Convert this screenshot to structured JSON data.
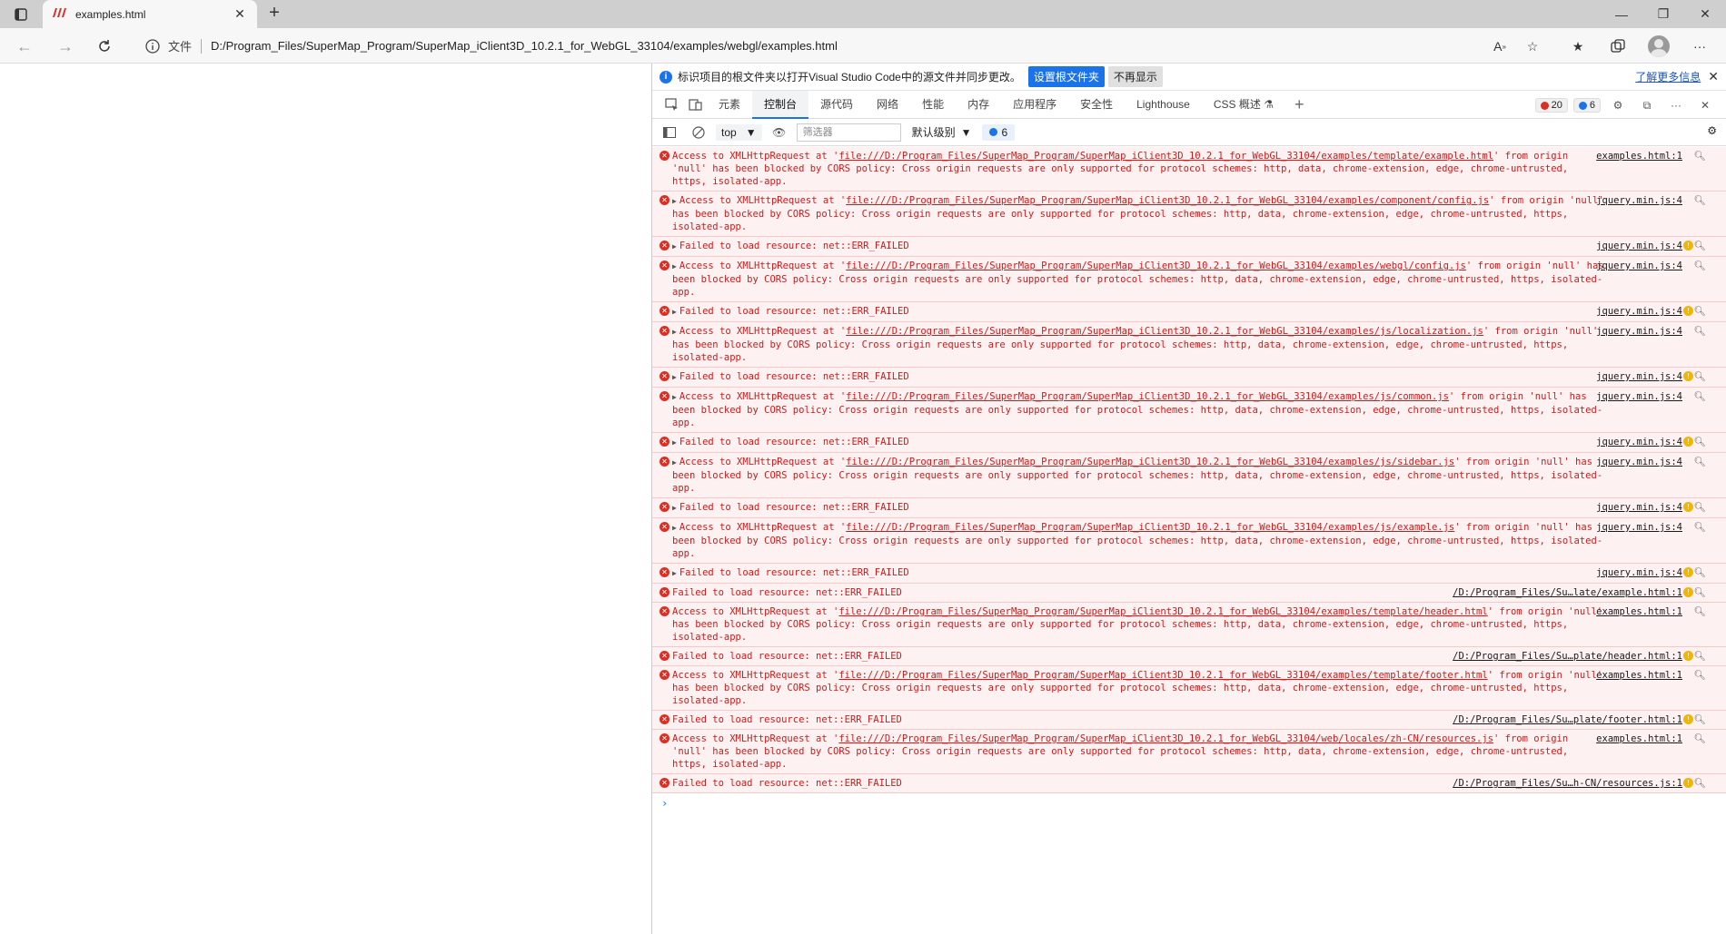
{
  "browser": {
    "tab_title": "examples.html",
    "address_label": "文件",
    "url": "D:/Program_Files/SuperMap_Program/SuperMap_iClient3D_10.2.1_for_WebGL_33104/examples/webgl/examples.html"
  },
  "devtools": {
    "infobar": {
      "message": "标识项目的根文件夹以打开Visual Studio Code中的源文件并同步更改。",
      "primary_button": "设置根文件夹",
      "secondary_button": "不再显示",
      "learn_more": "了解更多信息"
    },
    "tabs": [
      "元素",
      "控制台",
      "源代码",
      "网络",
      "性能",
      "内存",
      "应用程序",
      "安全性",
      "Lighthouse",
      "CSS 概述"
    ],
    "active_tab": "控制台",
    "error_count": "20",
    "info_count": "6",
    "toolbar": {
      "context": "top",
      "filter_placeholder": "筛选器",
      "level": "默认级别",
      "issues_count": "6"
    },
    "messages": [
      {
        "expand": false,
        "pre": "Access to XMLHttpRequest at '",
        "link": "file:///D:/Program_Files/SuperMap_Program/SuperMap_iClient3D_10.2.1_for_WebGL_33104/examples/template/example.html",
        "post": "' from origin 'null' has been blocked by CORS policy: Cross origin requests are only supported for protocol schemes: http, data, chrome-extension, edge, chrome-untrusted, https, isolated-app.",
        "source": "examples.html:1",
        "warn": false
      },
      {
        "expand": true,
        "pre": "Access to XMLHttpRequest at '",
        "link": "file:///D:/Program_Files/SuperMap_Program/SuperMap_iClient3D_10.2.1_for_WebGL_33104/examples/component/config.js",
        "post": "' from origin 'null' has been blocked by CORS policy: Cross origin requests are only supported for protocol schemes: http, data, chrome-extension, edge, chrome-untrusted, https, isolated-app.",
        "source": "jquery.min.js:4",
        "warn": false
      },
      {
        "expand": true,
        "pre": "Failed to load resource: net::ERR_FAILED",
        "link": "",
        "post": "",
        "source": "jquery.min.js:4",
        "warn": true
      },
      {
        "expand": true,
        "pre": "Access to XMLHttpRequest at '",
        "link": "file:///D:/Program_Files/SuperMap_Program/SuperMap_iClient3D_10.2.1_for_WebGL_33104/examples/webgl/config.js",
        "post": "' from origin 'null' has been blocked by CORS policy: Cross origin requests are only supported for protocol schemes: http, data, chrome-extension, edge, chrome-untrusted, https, isolated-app.",
        "source": "jquery.min.js:4",
        "warn": false
      },
      {
        "expand": true,
        "pre": "Failed to load resource: net::ERR_FAILED",
        "link": "",
        "post": "",
        "source": "jquery.min.js:4",
        "warn": true
      },
      {
        "expand": true,
        "pre": "Access to XMLHttpRequest at '",
        "link": "file:///D:/Program_Files/SuperMap_Program/SuperMap_iClient3D_10.2.1_for_WebGL_33104/examples/js/localization.js",
        "post": "' from origin 'null' has been blocked by CORS policy: Cross origin requests are only supported for protocol schemes: http, data, chrome-extension, edge, chrome-untrusted, https, isolated-app.",
        "source": "jquery.min.js:4",
        "warn": false
      },
      {
        "expand": true,
        "pre": "Failed to load resource: net::ERR_FAILED",
        "link": "",
        "post": "",
        "source": "jquery.min.js:4",
        "warn": true
      },
      {
        "expand": true,
        "pre": "Access to XMLHttpRequest at '",
        "link": "file:///D:/Program_Files/SuperMap_Program/SuperMap_iClient3D_10.2.1_for_WebGL_33104/examples/js/common.js",
        "post": "' from origin 'null' has been blocked by CORS policy: Cross origin requests are only supported for protocol schemes: http, data, chrome-extension, edge, chrome-untrusted, https, isolated-app.",
        "source": "jquery.min.js:4",
        "warn": false
      },
      {
        "expand": true,
        "pre": "Failed to load resource: net::ERR_FAILED",
        "link": "",
        "post": "",
        "source": "jquery.min.js:4",
        "warn": true
      },
      {
        "expand": true,
        "pre": "Access to XMLHttpRequest at '",
        "link": "file:///D:/Program_Files/SuperMap_Program/SuperMap_iClient3D_10.2.1_for_WebGL_33104/examples/js/sidebar.js",
        "post": "' from origin 'null' has been blocked by CORS policy: Cross origin requests are only supported for protocol schemes: http, data, chrome-extension, edge, chrome-untrusted, https, isolated-app.",
        "source": "jquery.min.js:4",
        "warn": false
      },
      {
        "expand": true,
        "pre": "Failed to load resource: net::ERR_FAILED",
        "link": "",
        "post": "",
        "source": "jquery.min.js:4",
        "warn": true
      },
      {
        "expand": true,
        "pre": "Access to XMLHttpRequest at '",
        "link": "file:///D:/Program_Files/SuperMap_Program/SuperMap_iClient3D_10.2.1_for_WebGL_33104/examples/js/example.js",
        "post": "' from origin 'null' has been blocked by CORS policy: Cross origin requests are only supported for protocol schemes: http, data, chrome-extension, edge, chrome-untrusted, https, isolated-app.",
        "source": "jquery.min.js:4",
        "warn": false
      },
      {
        "expand": true,
        "pre": "Failed to load resource: net::ERR_FAILED",
        "link": "",
        "post": "",
        "source": "jquery.min.js:4",
        "warn": true
      },
      {
        "expand": false,
        "pre": "Failed to load resource: net::ERR_FAILED",
        "link": "",
        "post": "",
        "source": "/D:/Program_Files/Su…late/example.html:1",
        "warn": true
      },
      {
        "expand": false,
        "pre": "Access to XMLHttpRequest at '",
        "link": "file:///D:/Program_Files/SuperMap_Program/SuperMap_iClient3D_10.2.1_for_WebGL_33104/examples/template/header.html",
        "post": "' from origin 'null' has been blocked by CORS policy: Cross origin requests are only supported for protocol schemes: http, data, chrome-extension, edge, chrome-untrusted, https, isolated-app.",
        "source": "examples.html:1",
        "warn": false
      },
      {
        "expand": false,
        "pre": "Failed to load resource: net::ERR_FAILED",
        "link": "",
        "post": "",
        "source": "/D:/Program_Files/Su…plate/header.html:1",
        "warn": true
      },
      {
        "expand": false,
        "pre": "Access to XMLHttpRequest at '",
        "link": "file:///D:/Program_Files/SuperMap_Program/SuperMap_iClient3D_10.2.1_for_WebGL_33104/examples/template/footer.html",
        "post": "' from origin 'null' has been blocked by CORS policy: Cross origin requests are only supported for protocol schemes: http, data, chrome-extension, edge, chrome-untrusted, https, isolated-app.",
        "source": "examples.html:1",
        "warn": false
      },
      {
        "expand": false,
        "pre": "Failed to load resource: net::ERR_FAILED",
        "link": "",
        "post": "",
        "source": "/D:/Program_Files/Su…plate/footer.html:1",
        "warn": true
      },
      {
        "expand": false,
        "pre": "Access to XMLHttpRequest at '",
        "link": "file:///D:/Program_Files/SuperMap_Program/SuperMap_iClient3D_10.2.1_for_WebGL_33104/web/locales/zh-CN/resources.js",
        "post": "' from origin 'null' has been blocked by CORS policy: Cross origin requests are only supported for protocol schemes: http, data, chrome-extension, edge, chrome-untrusted, https, isolated-app.",
        "source": "examples.html:1",
        "warn": false
      },
      {
        "expand": false,
        "pre": "Failed to load resource: net::ERR_FAILED",
        "link": "",
        "post": "",
        "source": "/D:/Program_Files/Su…h-CN/resources.js:1",
        "warn": true
      }
    ]
  }
}
